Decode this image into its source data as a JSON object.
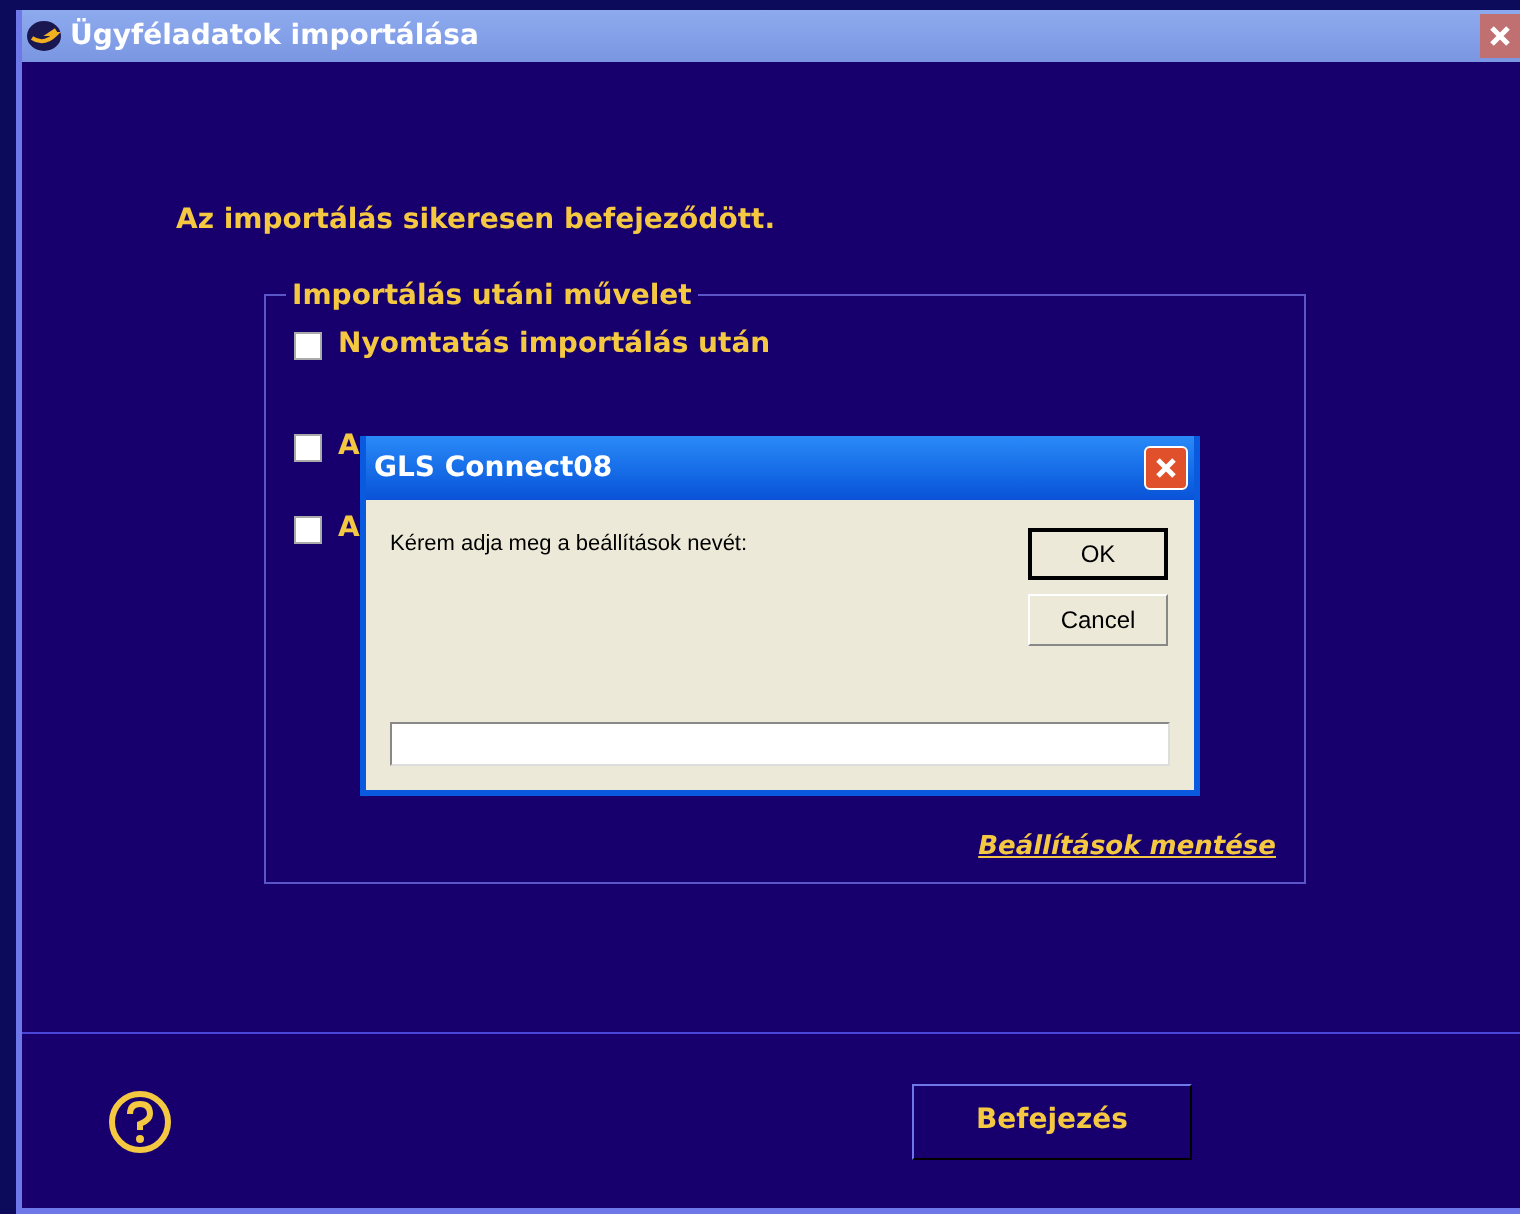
{
  "window": {
    "title": "Ügyféladatok importálása"
  },
  "message": "Az importálás sikeresen befejeződött.",
  "group": {
    "legend": "Importálás utáni művelet",
    "options": [
      {
        "label": "Nyomtatás importálás után",
        "checked": false
      },
      {
        "label": "A",
        "checked": false
      },
      {
        "label": "A",
        "checked": false
      }
    ],
    "link": "Beállítások mentése"
  },
  "finish_button": "Befejezés",
  "dialog": {
    "title": "GLS Connect08",
    "prompt": "Kérem adja meg a beállítások nevét:",
    "buttons": [
      {
        "label": "OK",
        "default": true
      },
      {
        "label": "Cancel",
        "default": false
      }
    ]
  }
}
